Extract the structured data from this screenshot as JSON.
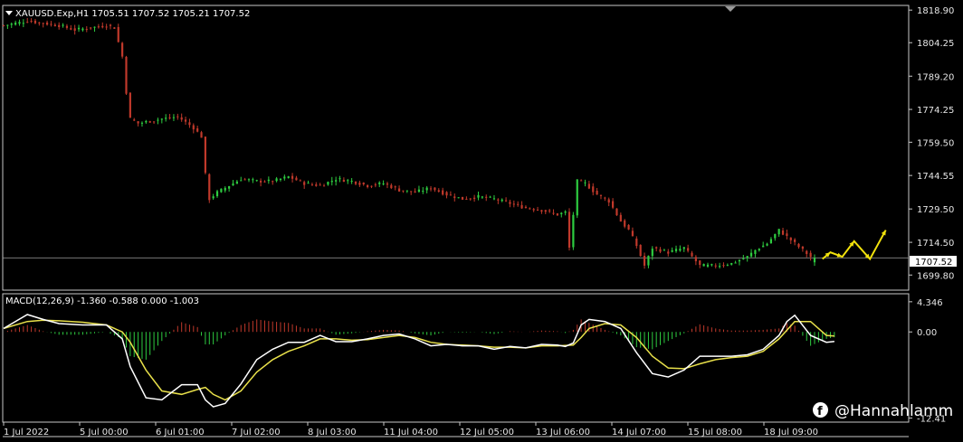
{
  "header": {
    "symbol_line": "XAUUSD.Exp,H1  1705.51 1707.52 1705.21 1707.52"
  },
  "macd_header": "MACD(12,26,9) -1.360 -0.588 0.000 -1.003",
  "current_price": "1707.52",
  "watermark": "@Hannahlamm",
  "colors": {
    "bg": "#000000",
    "bull": "#2ecc40",
    "bear": "#c0392b",
    "grid": "#c8c8c8",
    "macd_line": "#ffffff",
    "signal_line": "#e8e04a",
    "forecast": "#f2e20c",
    "price_line": "#a0a0a0"
  },
  "chart_data": [
    {
      "type": "candlestick",
      "symbol": "XAUUSD.Exp",
      "timeframe": "H1",
      "ohlc_last": {
        "open": 1705.51,
        "high": 1707.52,
        "low": 1705.21,
        "close": 1707.52
      },
      "ylim": [
        1693.0,
        1821.0
      ],
      "yticks": [
        "1818.90",
        "1804.25",
        "1789.20",
        "1774.25",
        "1759.50",
        "1744.55",
        "1729.50",
        "1714.50",
        "1699.80"
      ],
      "ytick_values": [
        1818.9,
        1804.25,
        1789.2,
        1774.25,
        1759.5,
        1744.55,
        1729.5,
        1714.5,
        1699.8
      ],
      "xticks": [
        "1 Jul 2022",
        "5 Jul 00:00",
        "6 Jul 01:00",
        "7 Jul 02:00",
        "8 Jul 03:00",
        "11 Jul 04:00",
        "12 Jul 05:00",
        "13 Jul 06:00",
        "14 Jul 07:00",
        "15 Jul 08:00",
        "18 Jul 09:00"
      ],
      "close_path": [
        [
          0,
          1812
        ],
        [
          6,
          1814
        ],
        [
          10,
          1813
        ],
        [
          14,
          1812
        ],
        [
          18,
          1810
        ],
        [
          22,
          1811
        ],
        [
          26,
          1812
        ],
        [
          28,
          1811
        ],
        [
          30,
          1798
        ],
        [
          31,
          1782
        ],
        [
          32,
          1770
        ],
        [
          34,
          1768
        ],
        [
          37,
          1769
        ],
        [
          40,
          1770
        ],
        [
          44,
          1771
        ],
        [
          48,
          1766
        ],
        [
          50,
          1762
        ],
        [
          51,
          1745
        ],
        [
          52,
          1734
        ],
        [
          54,
          1737
        ],
        [
          57,
          1740
        ],
        [
          60,
          1743
        ],
        [
          64,
          1742
        ],
        [
          68,
          1742
        ],
        [
          72,
          1744
        ],
        [
          76,
          1741
        ],
        [
          80,
          1740
        ],
        [
          84,
          1743
        ],
        [
          88,
          1742
        ],
        [
          92,
          1740
        ],
        [
          96,
          1741
        ],
        [
          100,
          1738
        ],
        [
          104,
          1737
        ],
        [
          108,
          1739
        ],
        [
          112,
          1736
        ],
        [
          116,
          1734
        ],
        [
          120,
          1735
        ],
        [
          124,
          1734
        ],
        [
          128,
          1732
        ],
        [
          132,
          1730
        ],
        [
          136,
          1729
        ],
        [
          140,
          1727
        ],
        [
          142,
          1728
        ],
        [
          143,
          1712
        ],
        [
          145,
          1742
        ],
        [
          147,
          1741
        ],
        [
          150,
          1736
        ],
        [
          153,
          1733
        ],
        [
          156,
          1724
        ],
        [
          158,
          1720
        ],
        [
          160,
          1713
        ],
        [
          162,
          1704
        ],
        [
          164,
          1712
        ],
        [
          168,
          1710
        ],
        [
          172,
          1712
        ],
        [
          174,
          1708
        ],
        [
          176,
          1704
        ],
        [
          180,
          1704
        ],
        [
          184,
          1705
        ],
        [
          188,
          1708
        ],
        [
          190,
          1711
        ],
        [
          193,
          1714
        ],
        [
          196,
          1720
        ],
        [
          198,
          1717
        ],
        [
          200,
          1714
        ],
        [
          202,
          1711
        ],
        [
          204,
          1708
        ],
        [
          205,
          1707.52
        ]
      ],
      "forecast_path": [
        [
          207,
          1707
        ],
        [
          209,
          1710
        ],
        [
          212,
          1708
        ],
        [
          215,
          1715
        ],
        [
          219,
          1707
        ],
        [
          223,
          1720
        ]
      ],
      "current_price": 1707.52
    },
    {
      "type": "macd",
      "params": "12,26,9",
      "values": {
        "macd": -1.36,
        "signal": -0.588,
        "zero": 0.0,
        "histogram": -1.003
      },
      "ylim": [
        -13.0,
        5.5
      ],
      "yticks": [
        "4.346",
        "0.00",
        "-12.41"
      ],
      "ytick_values": [
        4.346,
        0.0,
        -12.41
      ],
      "macd_line": [
        [
          0,
          0.5
        ],
        [
          6,
          2.5
        ],
        [
          10,
          1.8
        ],
        [
          14,
          1.2
        ],
        [
          20,
          1.0
        ],
        [
          26,
          1.0
        ],
        [
          30,
          -1.0
        ],
        [
          32,
          -5.0
        ],
        [
          36,
          -9.5
        ],
        [
          40,
          -9.8
        ],
        [
          45,
          -7.6
        ],
        [
          49,
          -7.6
        ],
        [
          51,
          -9.8
        ],
        [
          53,
          -10.8
        ],
        [
          56,
          -10.3
        ],
        [
          60,
          -7.5
        ],
        [
          64,
          -4.0
        ],
        [
          68,
          -2.5
        ],
        [
          72,
          -1.5
        ],
        [
          76,
          -1.5
        ],
        [
          80,
          -0.5
        ],
        [
          84,
          -1.4
        ],
        [
          88,
          -1.4
        ],
        [
          92,
          -1.0
        ],
        [
          96,
          -0.5
        ],
        [
          100,
          -0.3
        ],
        [
          104,
          -1.0
        ],
        [
          108,
          -2.0
        ],
        [
          112,
          -1.8
        ],
        [
          116,
          -2.0
        ],
        [
          120,
          -2.0
        ],
        [
          124,
          -2.5
        ],
        [
          128,
          -2.1
        ],
        [
          132,
          -2.3
        ],
        [
          136,
          -1.8
        ],
        [
          140,
          -1.9
        ],
        [
          142,
          -2.1
        ],
        [
          144,
          -1.6
        ],
        [
          146,
          1.0
        ],
        [
          148,
          1.8
        ],
        [
          152,
          1.5
        ],
        [
          156,
          0.5
        ],
        [
          160,
          -3.0
        ],
        [
          164,
          -6.0
        ],
        [
          168,
          -6.5
        ],
        [
          172,
          -5.5
        ],
        [
          176,
          -3.5
        ],
        [
          180,
          -3.5
        ],
        [
          184,
          -3.5
        ],
        [
          188,
          -3.3
        ],
        [
          192,
          -2.5
        ],
        [
          196,
          -0.5
        ],
        [
          198,
          1.5
        ],
        [
          200,
          2.4
        ],
        [
          204,
          -0.5
        ],
        [
          208,
          -1.5
        ],
        [
          210,
          -1.36
        ]
      ],
      "signal_line": [
        [
          0,
          0.5
        ],
        [
          6,
          1.5
        ],
        [
          10,
          1.7
        ],
        [
          14,
          1.6
        ],
        [
          20,
          1.4
        ],
        [
          26,
          1.0
        ],
        [
          30,
          0.0
        ],
        [
          32,
          -1.5
        ],
        [
          36,
          -5.5
        ],
        [
          40,
          -8.5
        ],
        [
          45,
          -9.0
        ],
        [
          49,
          -8.3
        ],
        [
          51,
          -8.0
        ],
        [
          53,
          -9.0
        ],
        [
          56,
          -9.8
        ],
        [
          60,
          -8.5
        ],
        [
          64,
          -5.8
        ],
        [
          68,
          -4.0
        ],
        [
          72,
          -2.8
        ],
        [
          76,
          -2.0
        ],
        [
          80,
          -1.0
        ],
        [
          84,
          -1.0
        ],
        [
          88,
          -1.2
        ],
        [
          92,
          -1.1
        ],
        [
          96,
          -0.8
        ],
        [
          100,
          -0.5
        ],
        [
          104,
          -0.8
        ],
        [
          108,
          -1.5
        ],
        [
          112,
          -1.8
        ],
        [
          116,
          -1.9
        ],
        [
          120,
          -2.0
        ],
        [
          124,
          -2.2
        ],
        [
          128,
          -2.2
        ],
        [
          132,
          -2.3
        ],
        [
          136,
          -2.0
        ],
        [
          140,
          -2.0
        ],
        [
          144,
          -1.9
        ],
        [
          146,
          -0.8
        ],
        [
          148,
          0.5
        ],
        [
          152,
          1.2
        ],
        [
          156,
          1.0
        ],
        [
          160,
          -0.8
        ],
        [
          164,
          -3.5
        ],
        [
          168,
          -5.2
        ],
        [
          172,
          -5.3
        ],
        [
          176,
          -4.6
        ],
        [
          180,
          -4.0
        ],
        [
          184,
          -3.7
        ],
        [
          188,
          -3.5
        ],
        [
          192,
          -2.8
        ],
        [
          196,
          -1.0
        ],
        [
          200,
          1.5
        ],
        [
          204,
          1.5
        ],
        [
          208,
          -0.5
        ],
        [
          210,
          -0.588
        ]
      ]
    }
  ]
}
